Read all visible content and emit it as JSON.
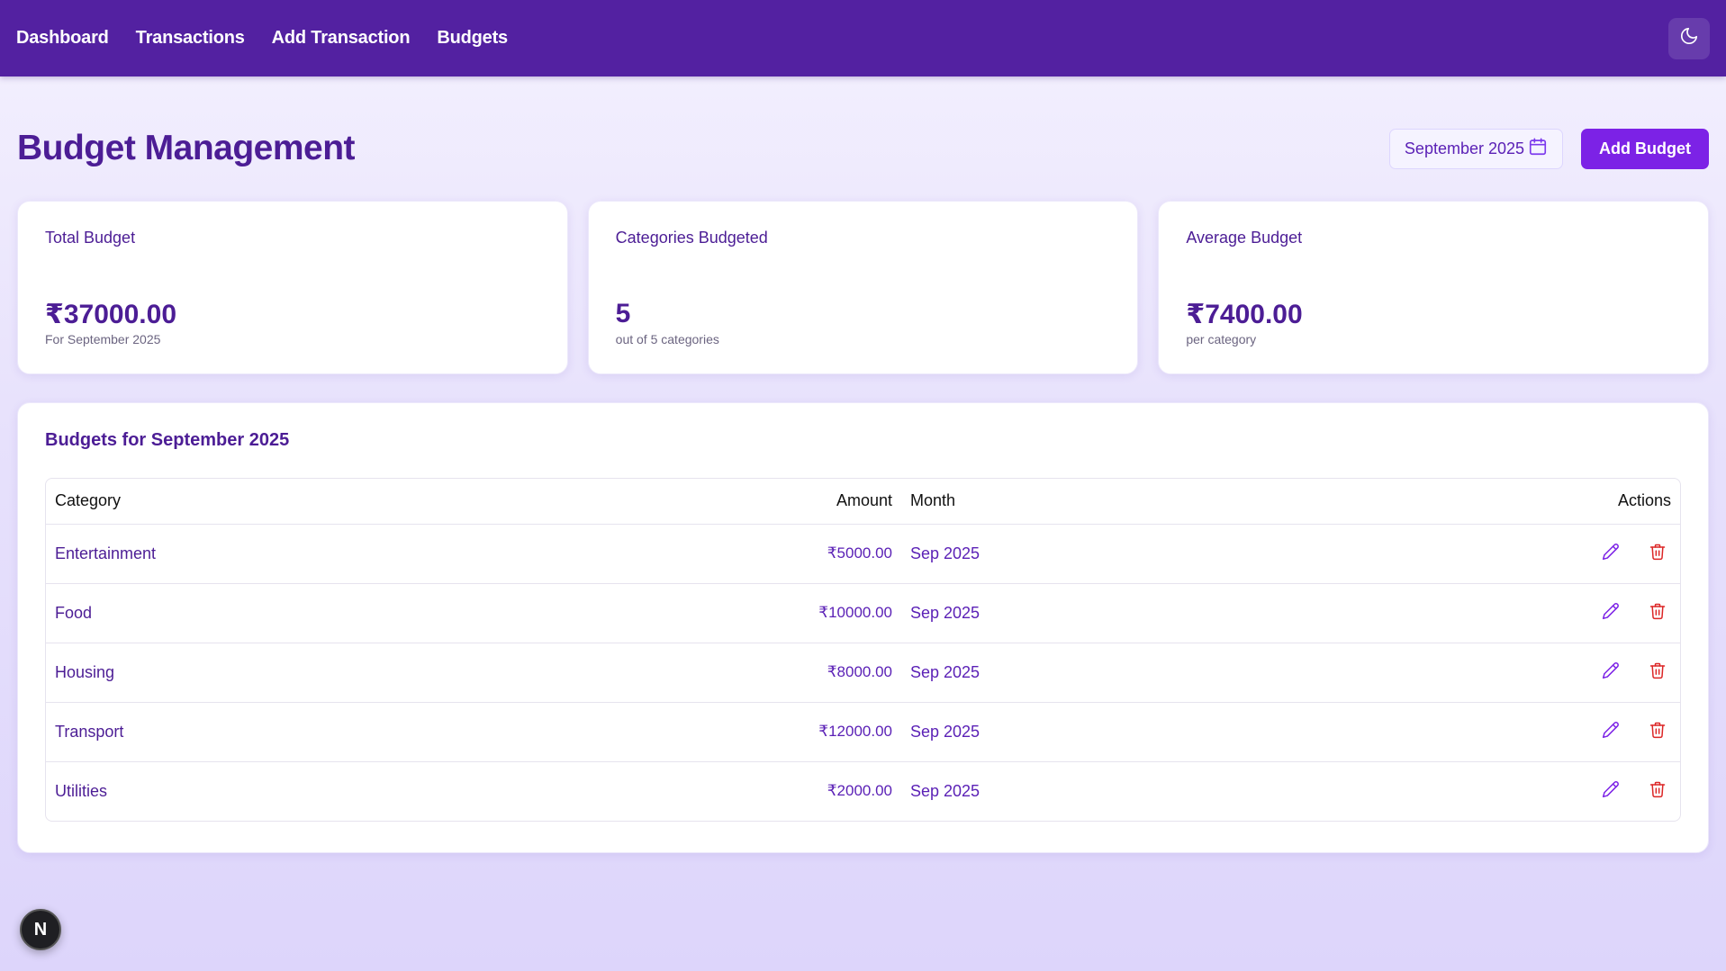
{
  "nav": {
    "links": [
      "Dashboard",
      "Transactions",
      "Add Transaction",
      "Budgets"
    ],
    "theme_toggle_icon": "moon-icon"
  },
  "header": {
    "title": "Budget Management",
    "month_picker": "September 2025",
    "calendar_icon": "calendar-icon",
    "add_button": "Add Budget"
  },
  "cards": [
    {
      "label": "Total Budget",
      "value": "₹37000.00",
      "sub": "For September 2025"
    },
    {
      "label": "Categories Budgeted",
      "value": "5",
      "sub": "out of 5 categories"
    },
    {
      "label": "Average Budget",
      "value": "₹7400.00",
      "sub": "per category"
    }
  ],
  "table": {
    "title": "Budgets for September 2025",
    "headers": {
      "category": "Category",
      "amount": "Amount",
      "month": "Month",
      "actions": "Actions"
    },
    "rows": [
      {
        "category": "Entertainment",
        "amount": "₹5000.00",
        "month": "Sep 2025"
      },
      {
        "category": "Food",
        "amount": "₹10000.00",
        "month": "Sep 2025"
      },
      {
        "category": "Housing",
        "amount": "₹8000.00",
        "month": "Sep 2025"
      },
      {
        "category": "Transport",
        "amount": "₹12000.00",
        "month": "Sep 2025"
      },
      {
        "category": "Utilities",
        "amount": "₹2000.00",
        "month": "Sep 2025"
      }
    ],
    "edit_icon": "pencil-icon",
    "delete_icon": "trash-icon"
  },
  "colors": {
    "nav": "#5321a1",
    "primary": "#7c22e6",
    "text": "#4c1d95",
    "delete": "#dc2626"
  },
  "dev_badge": "N"
}
